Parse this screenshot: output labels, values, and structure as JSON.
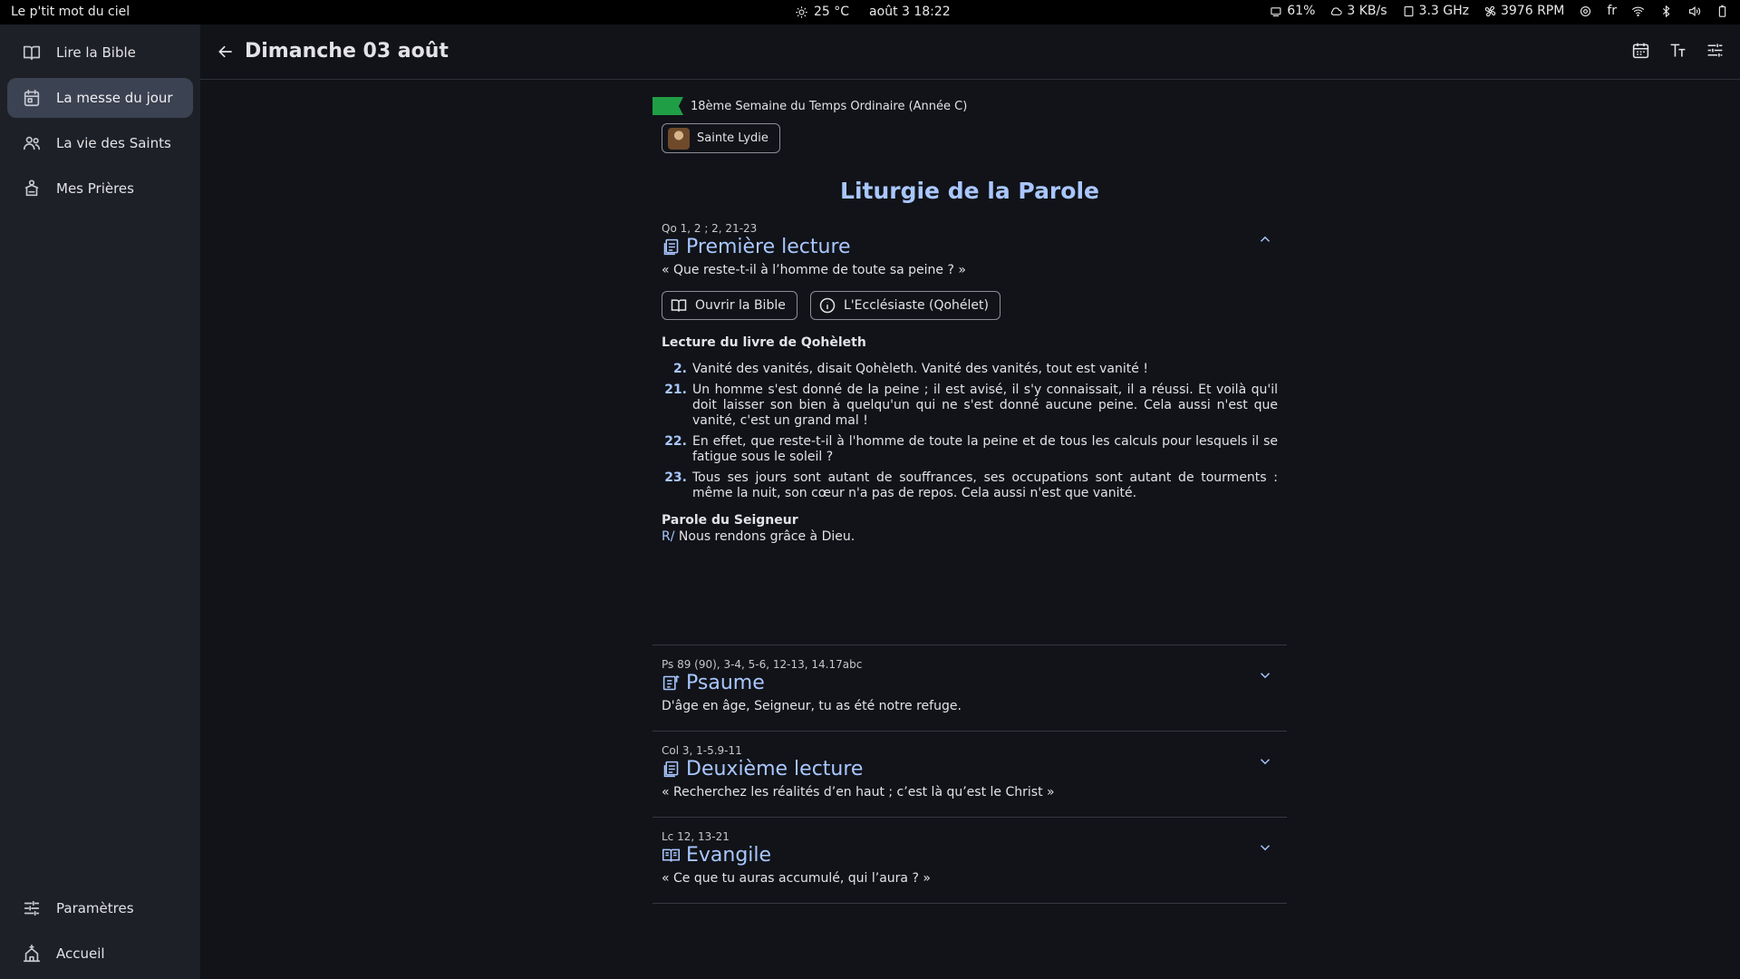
{
  "topbar": {
    "app_name": "Le p'tit mot du ciel",
    "weather": "25 °C",
    "datetime": "août 3  18:22",
    "battery_saver": "61%",
    "network": "3 KB/s",
    "cpu": "3.3 GHz",
    "fan": "3976 RPM",
    "lang": "fr"
  },
  "sidebar": {
    "items": [
      {
        "label": "Lire la Bible",
        "icon": "book-open-icon"
      },
      {
        "label": "La messe du jour",
        "icon": "calendar-icon"
      },
      {
        "label": "La vie des Saints",
        "icon": "people-icon"
      },
      {
        "label": "Mes Prières",
        "icon": "prayer-icon"
      }
    ],
    "bottom_items": [
      {
        "label": "Paramètres",
        "icon": "settings-sliders-icon"
      },
      {
        "label": "Accueil",
        "icon": "church-icon"
      }
    ]
  },
  "header": {
    "title": "Dimanche 03 août"
  },
  "main": {
    "week_label": "18ème Semaine du Temps Ordinaire (Année C)",
    "liturgical_color": "#1f9e45",
    "saint": "Sainte Lydie",
    "section_title": "Liturgie de la Parole",
    "readings": [
      {
        "ref": "Qo 1, 2 ; 2, 21-23",
        "title": "Première lecture",
        "subtitle": "« Que reste-t-il à l’homme de toute sa peine ? »",
        "expanded": true,
        "buttons": [
          "Ouvrir la Bible",
          "L'Ecclésiaste (Qohélet)"
        ],
        "book_heading": "Lecture du livre de Qohèleth",
        "verses": [
          {
            "num": "2.",
            "text": "Vanité des vanités, disait Qohèleth. Vanité des vanités, tout est vanité !"
          },
          {
            "num": "21.",
            "text": "Un homme s'est donné de la peine ; il est avisé, il s'y connaissait, il a réussi. Et voilà qu'il doit laisser son bien à quelqu'un qui ne s'est donné aucune peine. Cela aussi n'est que vanité, c'est un grand mal !"
          },
          {
            "num": "22.",
            "text": "En effet, que reste-t-il à l'homme de toute la peine et de tous les calculs pour lesquels il se fatigue sous le soleil ?"
          },
          {
            "num": "23.",
            "text": "Tous ses jours sont autant de souffrances, ses occupations sont autant de tourments : même la nuit, son cœur n'a pas de repos. Cela aussi n'est que vanité."
          }
        ],
        "closing": "Parole du Seigneur",
        "response_marker": "R/",
        "response": " Nous rendons grâce à Dieu."
      },
      {
        "ref": "Ps 89 (90), 3-4, 5-6, 12-13, 14.17abc",
        "title": "Psaume",
        "subtitle": "D'âge en âge, Seigneur, tu as été notre refuge.",
        "expanded": false
      },
      {
        "ref": "Col 3, 1-5.9-11",
        "title": "Deuxième lecture",
        "subtitle": "« Recherchez les réalités d’en haut ; c’est là qu’est le Christ »",
        "expanded": false
      },
      {
        "ref": "Lc 12, 13-21",
        "title": "Evangile",
        "subtitle": "« Ce que tu auras accumulé, qui l’aura ? »",
        "expanded": false
      }
    ]
  }
}
